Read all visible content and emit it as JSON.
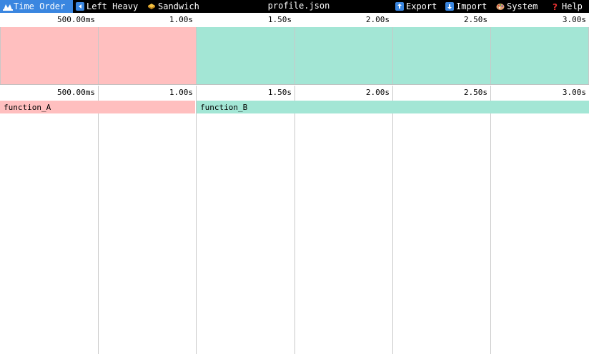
{
  "toolbar": {
    "tabs": [
      {
        "label": "Time Order",
        "icon": "time-order-icon",
        "active": true
      },
      {
        "label": "Left Heavy",
        "icon": "left-heavy-icon",
        "active": false
      },
      {
        "label": "Sandwich",
        "icon": "sandwich-icon",
        "active": false
      }
    ],
    "title": "profile.json",
    "actions": [
      {
        "label": "Export",
        "icon": "export-icon"
      },
      {
        "label": "Import",
        "icon": "import-icon"
      },
      {
        "label": "System",
        "icon": "palette-icon"
      },
      {
        "label": "Help",
        "icon": "help-icon"
      }
    ]
  },
  "ticks": [
    "500.00ms",
    "1.00s",
    "1.50s",
    "2.00s",
    "2.50s",
    "3.00s"
  ],
  "frames": [
    {
      "name": "function_A",
      "color": "#ffbfbf"
    },
    {
      "name": "function_B",
      "color": "#a3e6d5"
    }
  ],
  "colors": {
    "active_tab": "#3a86e0",
    "toolbar_bg": "#000000",
    "grid": "#c8c8c8"
  }
}
